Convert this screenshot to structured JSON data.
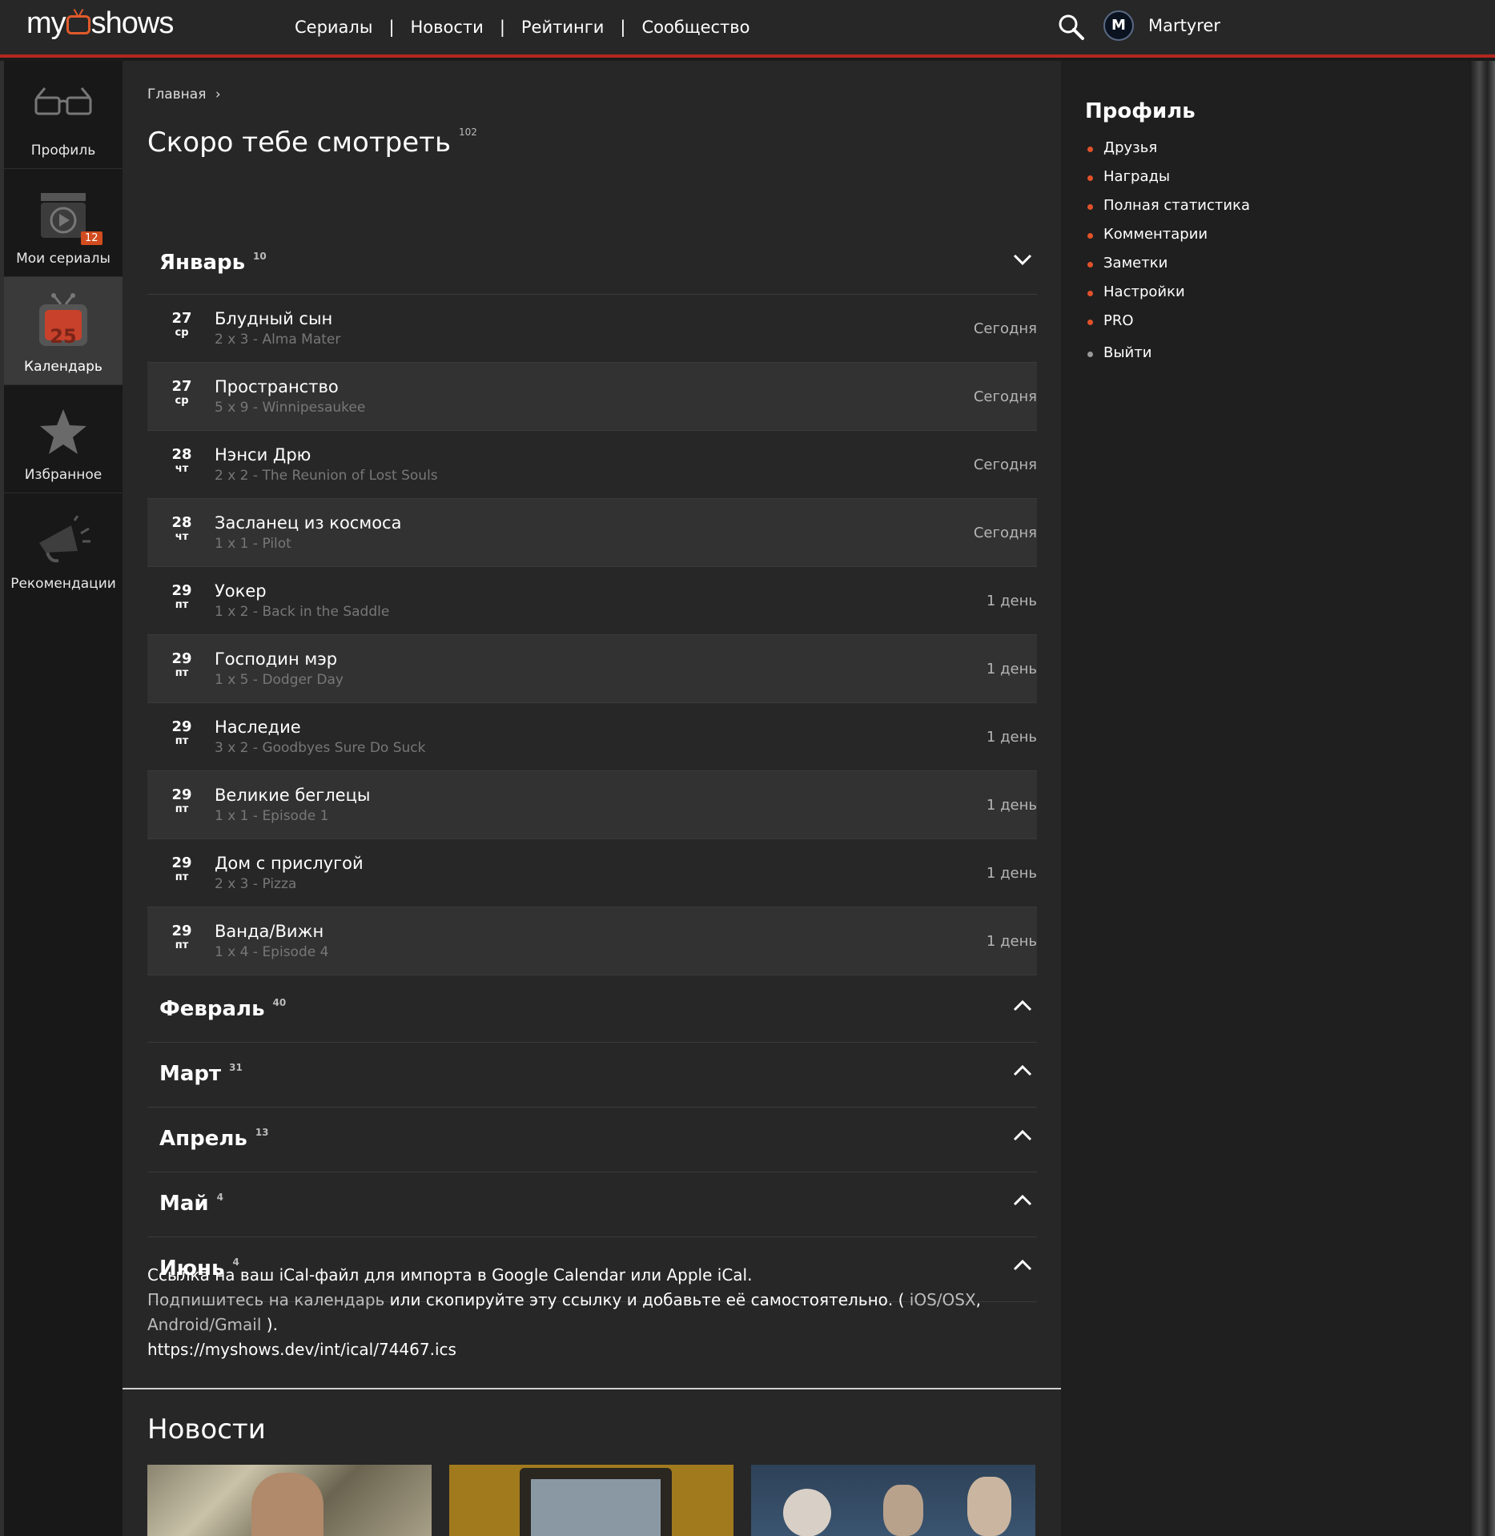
{
  "header": {
    "logo_text": "my shows",
    "nav": [
      {
        "label": "Сериалы"
      },
      {
        "label": "Новости"
      },
      {
        "label": "Рейтинги"
      },
      {
        "label": "Сообщество"
      }
    ],
    "separator": "|",
    "avatar_letter": "M",
    "username": "Martyrer"
  },
  "sidebar": {
    "items": [
      {
        "label": "Профиль",
        "icon": "glasses-icon"
      },
      {
        "label": "Мои сериалы",
        "icon": "play-clapper-icon",
        "badge": "12"
      },
      {
        "label": "Календарь",
        "icon": "tv-calendar-icon",
        "day": "25",
        "active": true
      },
      {
        "label": "Избранное",
        "icon": "star-icon"
      },
      {
        "label": "Рекомендации",
        "icon": "megaphone-icon"
      }
    ]
  },
  "main": {
    "breadcrumb": "Главная",
    "title": "Скоро тебе смотреть",
    "title_count": "102",
    "months": [
      {
        "name": "Январь",
        "count": "10",
        "expanded": true
      },
      {
        "name": "Февраль",
        "count": "40",
        "expanded": false
      },
      {
        "name": "Март",
        "count": "31",
        "expanded": false
      },
      {
        "name": "Апрель",
        "count": "13",
        "expanded": false
      },
      {
        "name": "Май",
        "count": "4",
        "expanded": false
      },
      {
        "name": "Июнь",
        "count": "4",
        "expanded": false
      }
    ],
    "episodes": [
      {
        "day": "27",
        "weekday": "ср",
        "show": "Блудный сын",
        "episode": "2 x 3 - Alma Mater",
        "when": "Сегодня"
      },
      {
        "day": "27",
        "weekday": "ср",
        "show": "Пространство",
        "episode": "5 x 9 - Winnipesaukee",
        "when": "Сегодня"
      },
      {
        "day": "28",
        "weekday": "чт",
        "show": "Нэнси Дрю",
        "episode": "2 x 2 - The Reunion of Lost Souls",
        "when": "Сегодня"
      },
      {
        "day": "28",
        "weekday": "чт",
        "show": "Засланец из космоса",
        "episode": "1 x 1 - Pilot",
        "when": "Сегодня"
      },
      {
        "day": "29",
        "weekday": "пт",
        "show": "Уокер",
        "episode": "1 x 2 - Back in the Saddle",
        "when": "1 день"
      },
      {
        "day": "29",
        "weekday": "пт",
        "show": "Господин мэр",
        "episode": "1 x 5 - Dodger Day",
        "when": "1 день"
      },
      {
        "day": "29",
        "weekday": "пт",
        "show": "Наследие",
        "episode": "3 x 2 - Goodbyes Sure Do Suck",
        "when": "1 день"
      },
      {
        "day": "29",
        "weekday": "пт",
        "show": "Великие беглецы",
        "episode": "1 x 1 - Episode 1",
        "when": "1 день"
      },
      {
        "day": "29",
        "weekday": "пт",
        "show": "Дом с прислугой",
        "episode": "2 x 3 - Pizza",
        "when": "1 день"
      },
      {
        "day": "29",
        "weekday": "пт",
        "show": "Ванда/Вижн",
        "episode": "1 x 4 - Episode 4",
        "when": "1 день"
      }
    ],
    "ical": {
      "line1": "Ссылка на ваш iCal-файл для импорта в Google Calendar или Apple iCal.",
      "subscribe_link": "Подпишитесь на календарь",
      "line2_mid": " или скопируйте эту ссылку и добавьте её самостоятельно. ( ",
      "ios_link": "iOS/OSX",
      "comma": ",",
      "android_link": "Android/Gmail",
      "close": " ).",
      "url": "https://myshows.dev/int/ical/74467.ics"
    },
    "news_title": "Новости"
  },
  "right": {
    "title": "Профиль",
    "links": [
      {
        "label": "Друзья"
      },
      {
        "label": "Награды"
      },
      {
        "label": "Полная статистика"
      },
      {
        "label": "Комментарии"
      },
      {
        "label": "Заметки"
      },
      {
        "label": "Настройки"
      },
      {
        "label": "PRO"
      }
    ],
    "logout": "Выйти"
  },
  "colors": {
    "accent": "#b3271f",
    "badge": "#d14c1f",
    "bullet": "#e0512a"
  }
}
